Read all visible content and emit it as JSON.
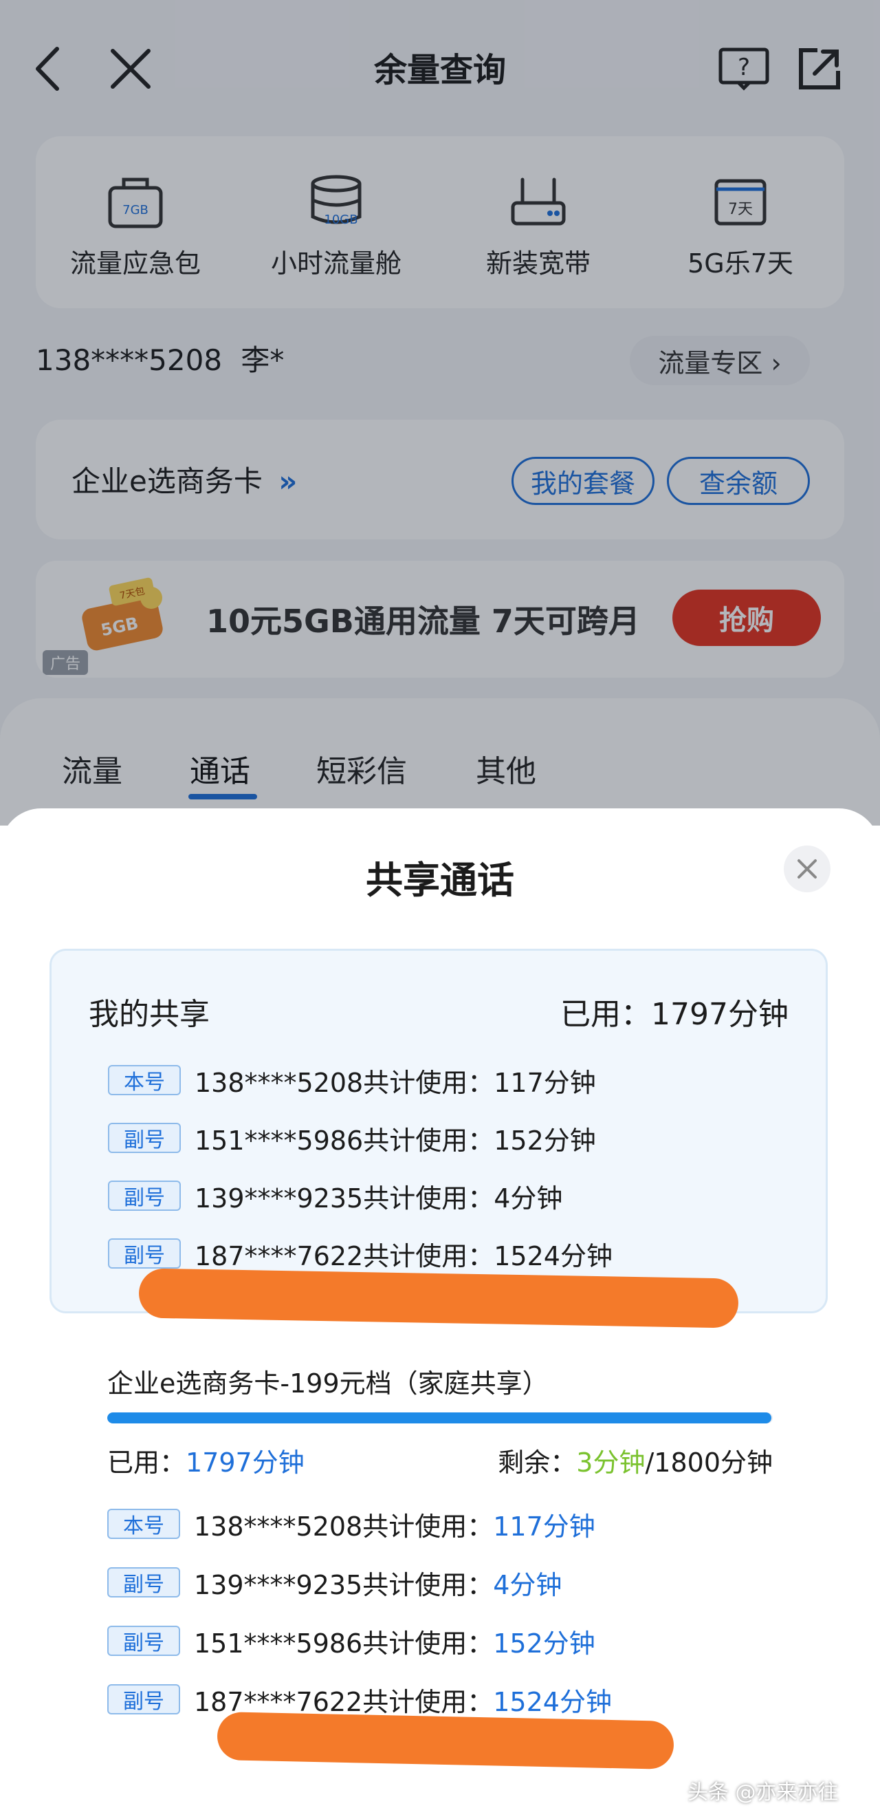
{
  "header": {
    "title": "余量查询"
  },
  "shortcuts": [
    {
      "label": "流量应急包",
      "icon": "bag-icon",
      "badge": "7GB"
    },
    {
      "label": "小时流量舱",
      "icon": "database-icon",
      "badge": "10GB"
    },
    {
      "label": "新装宽带",
      "icon": "router-icon",
      "badge": ""
    },
    {
      "label": "5G乐7天",
      "icon": "calendar-icon",
      "badge": "7天"
    }
  ],
  "user": {
    "phone": "138****5208",
    "name": "李*",
    "zone_label": "流量专区 ›"
  },
  "plan": {
    "name": "企业e选商务卡",
    "chevrons": "»",
    "btn_package": "我的套餐",
    "btn_balance": "查余额"
  },
  "ad": {
    "text": "10元5GB通用流量 7天可跨月",
    "button": "抢购",
    "tag": "广告",
    "image_badge": "5GB",
    "image_ribbon": "7天包"
  },
  "tabs": [
    {
      "label": "流量"
    },
    {
      "label": "通话"
    },
    {
      "label": "短彩信"
    },
    {
      "label": "其他"
    }
  ],
  "sheet": {
    "title": "共享通话",
    "my_share": {
      "label": "我的共享",
      "used": "已用：1797分钟",
      "rows": [
        {
          "tag": "本号",
          "number": "138****5208共计使用：",
          "value": "117分钟"
        },
        {
          "tag": "副号",
          "number": "151****5986共计使用：",
          "value": "152分钟"
        },
        {
          "tag": "副号",
          "number": "139****9235共计使用：",
          "value": "4分钟"
        },
        {
          "tag": "副号",
          "number": "187****7622共计使用：",
          "value": "1524分钟"
        }
      ]
    },
    "package": {
      "title": "企业e选商务卡-199元档（家庭共享）",
      "progress": 0.998,
      "used_label": "已用：",
      "used_value": "1797分钟",
      "remain_label": "剩余：",
      "remain_value": "3分钟",
      "total": "/1800分钟",
      "rows": [
        {
          "tag": "本号",
          "number": "138****5208共计使用：",
          "value": "117分钟"
        },
        {
          "tag": "副号",
          "number": "139****9235共计使用：",
          "value": "4分钟"
        },
        {
          "tag": "副号",
          "number": "151****5986共计使用：",
          "value": "152分钟"
        },
        {
          "tag": "副号",
          "number": "187****7622共计使用：",
          "value": "1524分钟"
        }
      ]
    }
  },
  "watermark": "头条 @亦来亦往",
  "colors": {
    "accent": "#1e6fd9",
    "remain": "#7ac22e",
    "ad_button": "#e3331f",
    "scribble": "#f47a2a"
  }
}
